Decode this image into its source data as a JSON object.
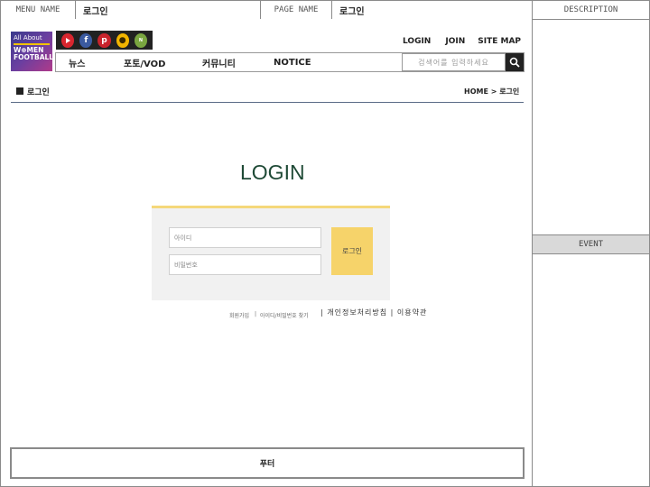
{
  "spec_header": {
    "menu_name_label": "MENU NAME",
    "menu_name_value": "로그인",
    "page_name_label": "PAGE NAME",
    "page_name_value": "로그인",
    "description_label": "DESCRIPTION"
  },
  "right_panel": {
    "event_label": "EVENT"
  },
  "site_header": {
    "logo": {
      "line1": "All About",
      "line2": "W⊕MEN",
      "line3": "FOOTBALL"
    },
    "social_icons": [
      "youtube-icon",
      "facebook-icon",
      "pinterest-icon",
      "kakao-icon",
      "naver-icon"
    ],
    "top_links": {
      "login": "LOGIN",
      "join": "JOIN",
      "sitemap": "SITE MAP"
    },
    "nav": {
      "news": "뉴스",
      "photo": "포토/VOD",
      "community": "커뮤니티",
      "notice": "NOTICE"
    },
    "search": {
      "placeholder": "검색어를 입력하세요"
    }
  },
  "page": {
    "section_title": "로그인",
    "breadcrumb": "HOME > 로그인",
    "heading": "LOGIN",
    "id_placeholder": "아이디",
    "password_placeholder": "비밀번호",
    "login_button": "로그인",
    "signup_link": "회원가입",
    "find_link": "아이디/비밀번호 찾기",
    "policy_links": "| 개인정보처리방침 | 이용약관"
  },
  "footer": {
    "label": "푸터"
  },
  "colors": {
    "heading": "#1f4a36",
    "login_button": "#f6d36a",
    "divider": "#5a6b86"
  }
}
